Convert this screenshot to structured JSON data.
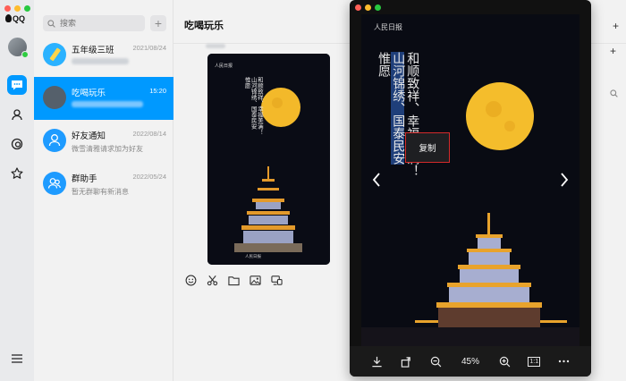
{
  "app": {
    "logo_text": "QQ"
  },
  "search": {
    "placeholder": "搜索"
  },
  "conversations": [
    {
      "name": "五年级三班",
      "time": "2021/08/24",
      "subtitle": ""
    },
    {
      "name": "吃喝玩乐",
      "time": "15:20",
      "subtitle": ""
    },
    {
      "name": "好友通知",
      "time": "2022/08/14",
      "subtitle": "微雪清雅请求加为好友"
    },
    {
      "name": "群助手",
      "time": "2022/05/24",
      "subtitle": "暂无群聊有新消息"
    }
  ],
  "chat": {
    "title": "吃喝玩乐"
  },
  "poster": {
    "brand": "人民日报",
    "line_1": "和顺致祥、幸福美满！",
    "line_2": "山河锦绣、国泰民安",
    "line_3": "惟愿",
    "credit": "人民日报"
  },
  "viewer": {
    "zoom": "45%",
    "ratio_label": "1:1",
    "context_menu_copy": "复制"
  },
  "colors": {
    "accent": "#0099ff",
    "active_row": "#0099ff",
    "highlight_border": "#d42a2a"
  }
}
